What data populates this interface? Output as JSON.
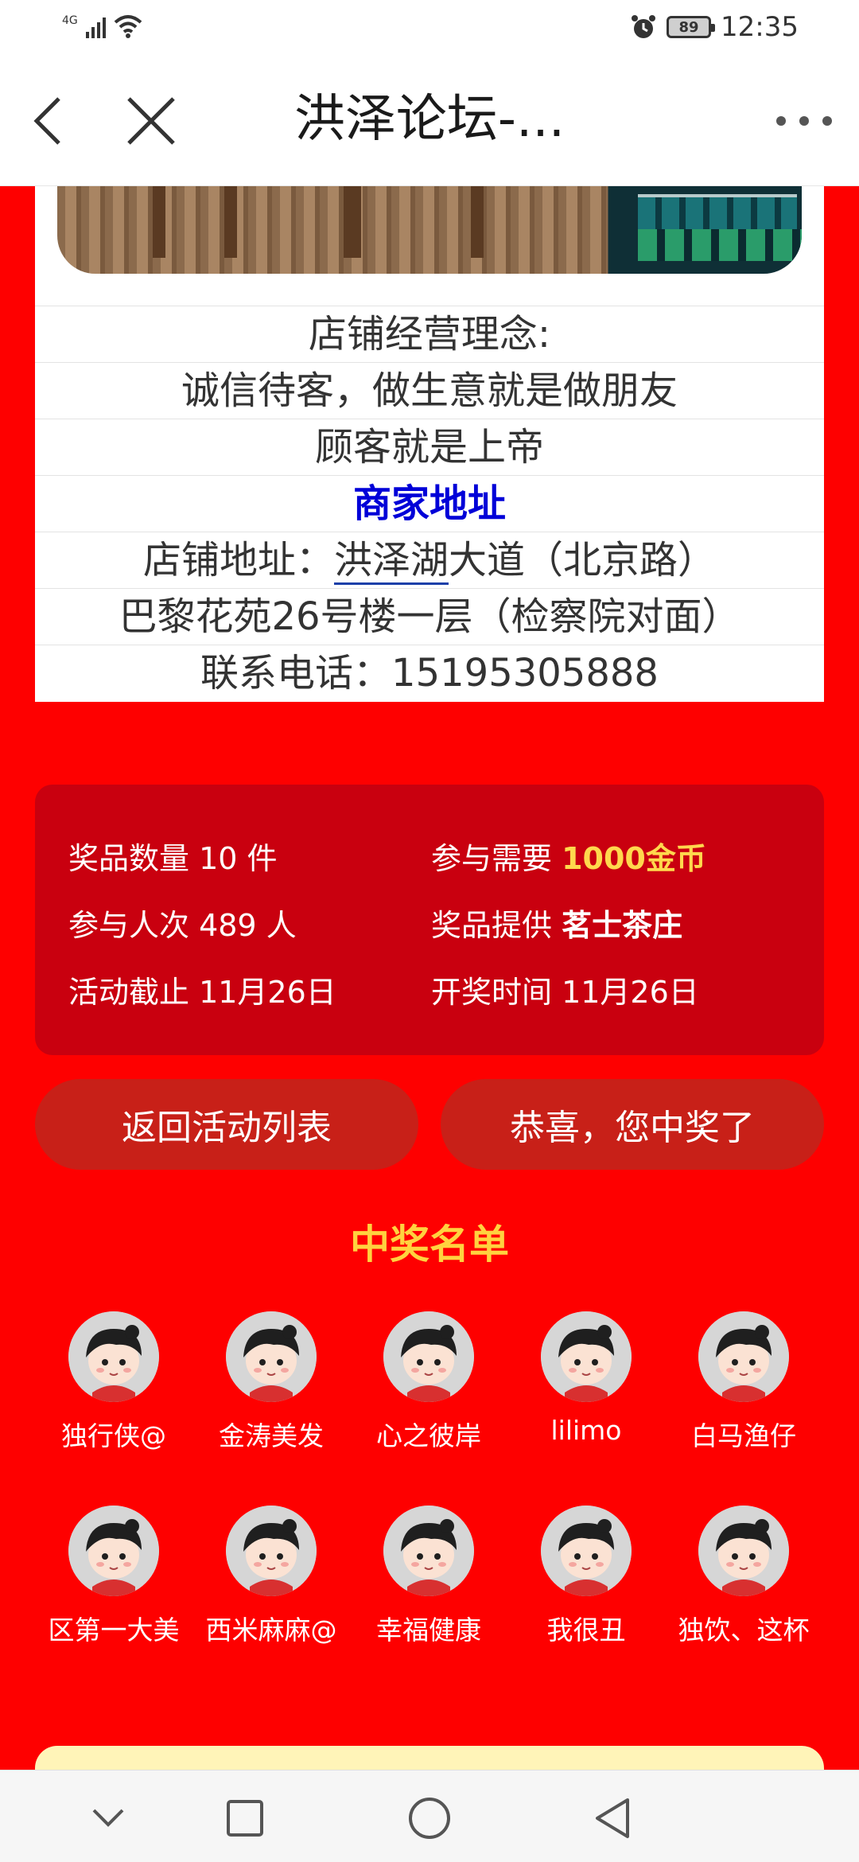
{
  "status_bar": {
    "network": "4G",
    "battery": "89",
    "time": "12:35"
  },
  "header": {
    "title": "洪泽论坛-..."
  },
  "store": {
    "lines": [
      "店铺经营理念:",
      "诚信待客，做生意就是做朋友",
      "顾客就是上帝",
      "商家地址"
    ],
    "address_prefix": "店铺地址：",
    "address_link": "洪泽湖",
    "address_rest": "大道（北京路）",
    "address_line2": "巴黎花苑26号楼一层（检察院对面）",
    "phone": "联系电话：15195305888"
  },
  "info": {
    "prize_count_label": "奖品数量 10 件",
    "cost_label": "参与需要",
    "cost_value": "1000金币",
    "participants_label": "参与人次 489 人",
    "provider_label": "奖品提供",
    "provider_value": "茗士茶庄",
    "deadline_label": "活动截止 11月26日",
    "draw_time_label": "开奖时间 11月26日"
  },
  "buttons": {
    "back_to_list": "返回活动列表",
    "congrats": "恭喜，您中奖了"
  },
  "winners": {
    "title": "中奖名单",
    "names": [
      "独行侠@",
      "金涛美发",
      "心之彼岸",
      "lilimo",
      "白马渔仔",
      "区第一大美",
      "西米麻麻@",
      "幸福健康",
      "我很丑",
      "独饮、这杯"
    ]
  },
  "colors": {
    "page_red": "#fe0000",
    "panel_red": "#c9000f",
    "button_red": "#c82018",
    "gold": "#ffd84d",
    "link_blue": "#0000d8"
  },
  "icons": [
    "back-arrow-icon",
    "close-icon",
    "more-icon",
    "wifi-icon",
    "alarm-icon",
    "nav-down-icon",
    "nav-square-icon",
    "nav-circle-icon",
    "nav-back-icon"
  ]
}
